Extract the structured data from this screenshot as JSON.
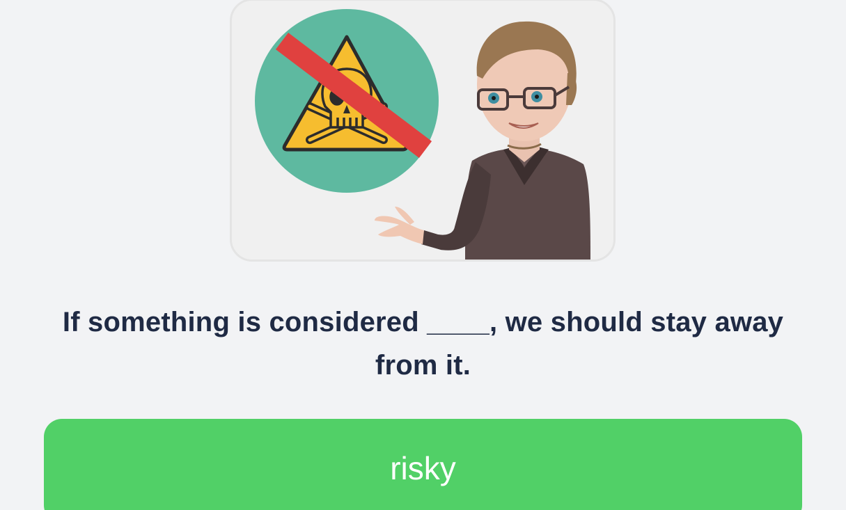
{
  "question": {
    "text": "If something is considered ____, we should stay away from it."
  },
  "answer": {
    "label": "risky"
  },
  "illustration": {
    "icons": [
      "no-poison-sign-icon",
      "skull-crossbones-icon",
      "teacher-character"
    ]
  },
  "colors": {
    "background": "#f2f3f5",
    "answer_button": "#51d067",
    "question_text": "#1f2a44",
    "sign_circle": "#5eb9a0",
    "warning_triangle": "#f6bd2f",
    "prohibition_bar": "#e0413f"
  }
}
